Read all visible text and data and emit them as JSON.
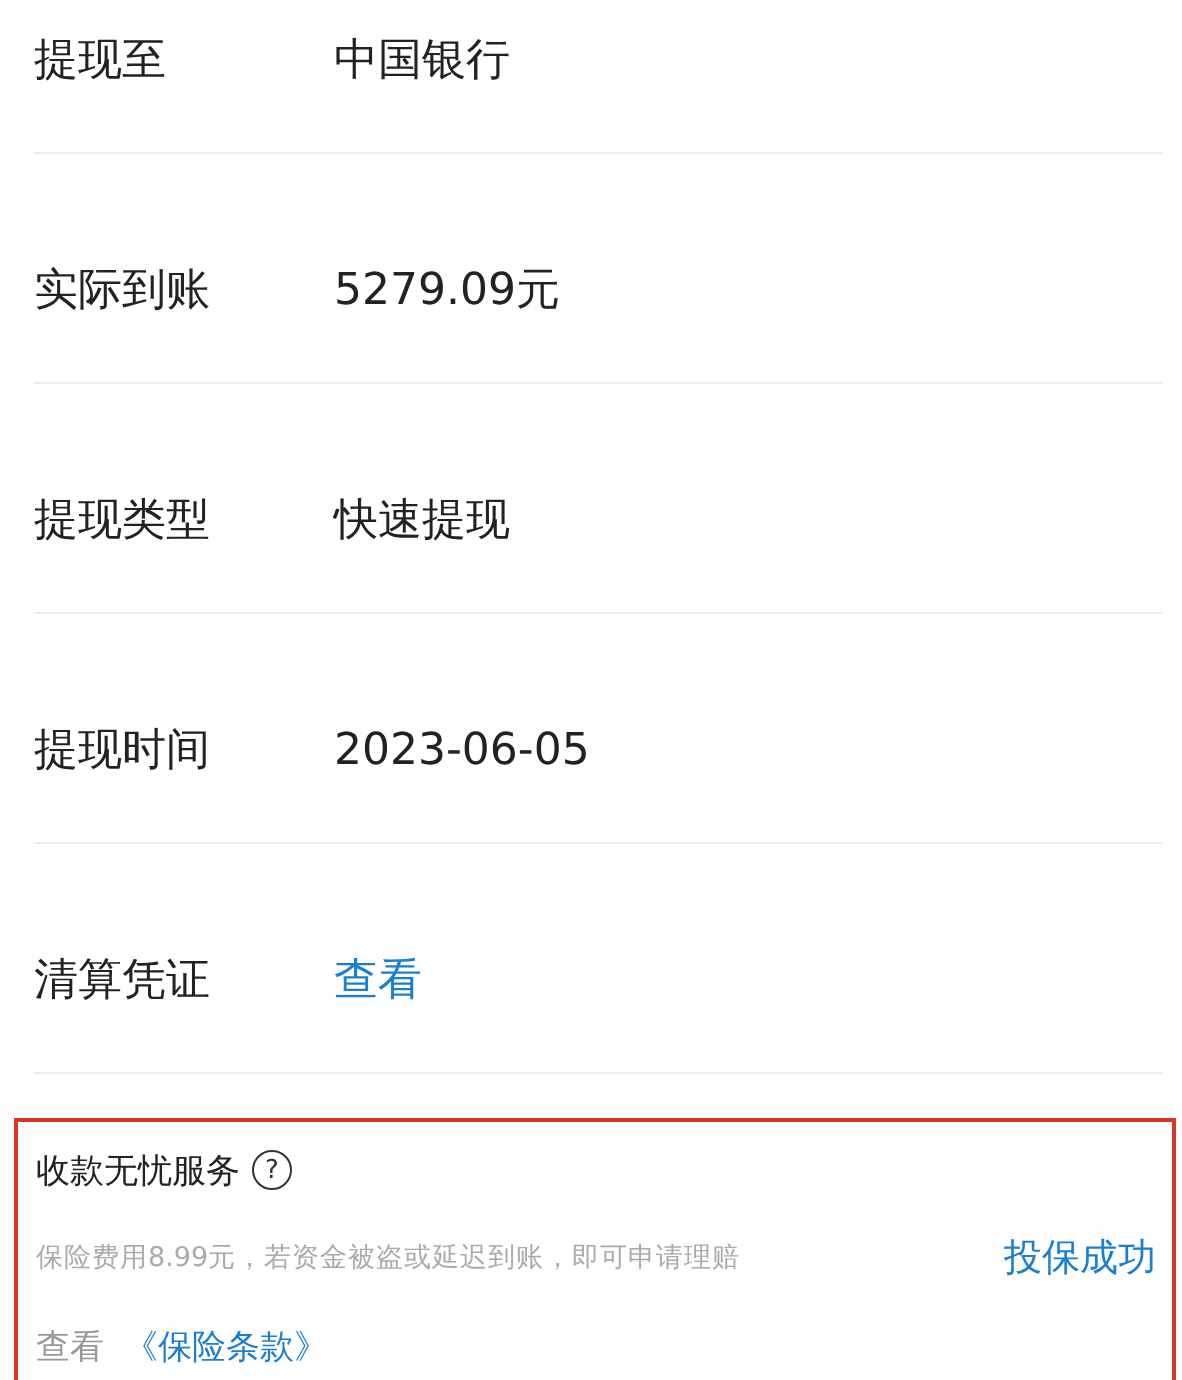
{
  "details": [
    {
      "label": "提现至",
      "value": "中国银行",
      "kind": "text"
    },
    {
      "label": "实际到账",
      "value": "5279.09元",
      "kind": "text"
    },
    {
      "label": "提现类型",
      "value": "快速提现",
      "kind": "text"
    },
    {
      "label": "提现时间",
      "value": "2023-06-05",
      "kind": "text"
    },
    {
      "label": "清算凭证",
      "value": "查看",
      "kind": "link"
    }
  ],
  "service": {
    "highlighted": true,
    "title": "收款无忧服务",
    "help_icon": "?",
    "description": "保险费用8.99元，若资金被盗或延迟到账，即可申请理赔",
    "status": "投保成功",
    "terms_prefix": "查看",
    "terms_link": "《保险条款》"
  }
}
